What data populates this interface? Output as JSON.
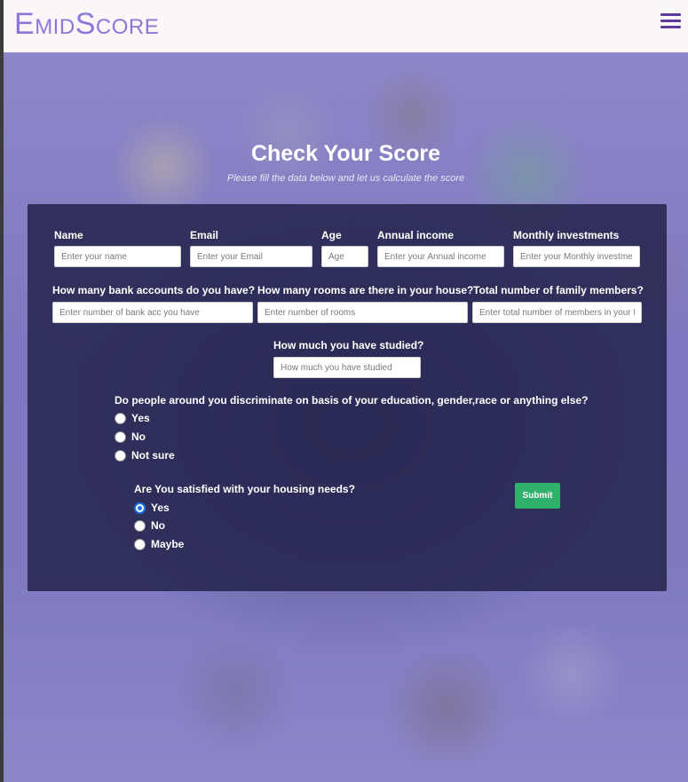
{
  "brand": {
    "logo_first_big": "E",
    "logo_first_rest": "MID",
    "logo_second_big": "S",
    "logo_second_rest": "CORE"
  },
  "hero": {
    "title": "Check Your Score",
    "subtitle": "Please fill the data below and let us calculate the score"
  },
  "form": {
    "name": {
      "label": "Name",
      "placeholder": "Enter your name"
    },
    "email": {
      "label": "Email",
      "placeholder": "Enter your Email"
    },
    "age": {
      "label": "Age",
      "placeholder": "Age"
    },
    "annual_income": {
      "label": "Annual income",
      "placeholder": "Enter your Annual income"
    },
    "monthly_investments": {
      "label": "Monthly investments",
      "placeholder": "Enter your Monthly investments"
    },
    "bank_accounts": {
      "label": "How many bank accounts do you have?",
      "placeholder": "Enter number of bank acc you have"
    },
    "rooms": {
      "label": "How many rooms are there in your house?",
      "placeholder": "Enter number of rooms"
    },
    "family_members": {
      "label": "Total number of family members?",
      "placeholder": "Enter total number of members in your family"
    },
    "studied": {
      "label": "How much you have studied?",
      "placeholder": "How much you have studied"
    },
    "discrimination": {
      "question": "Do people around you discriminate on basis of your education, gender,race or anything else?",
      "options": [
        "Yes",
        "No",
        "Not sure"
      ]
    },
    "housing": {
      "question": "Are You satisfied with your housing needs?",
      "options": [
        "Yes",
        "No",
        "Maybe"
      ],
      "selected": "Yes"
    },
    "submit_label": "Submit"
  },
  "colors": {
    "logo": "#8b78d8",
    "hamburger": "#5d3a9c",
    "submit": "#2fb16b",
    "radio_checked": "#1a73e8"
  }
}
